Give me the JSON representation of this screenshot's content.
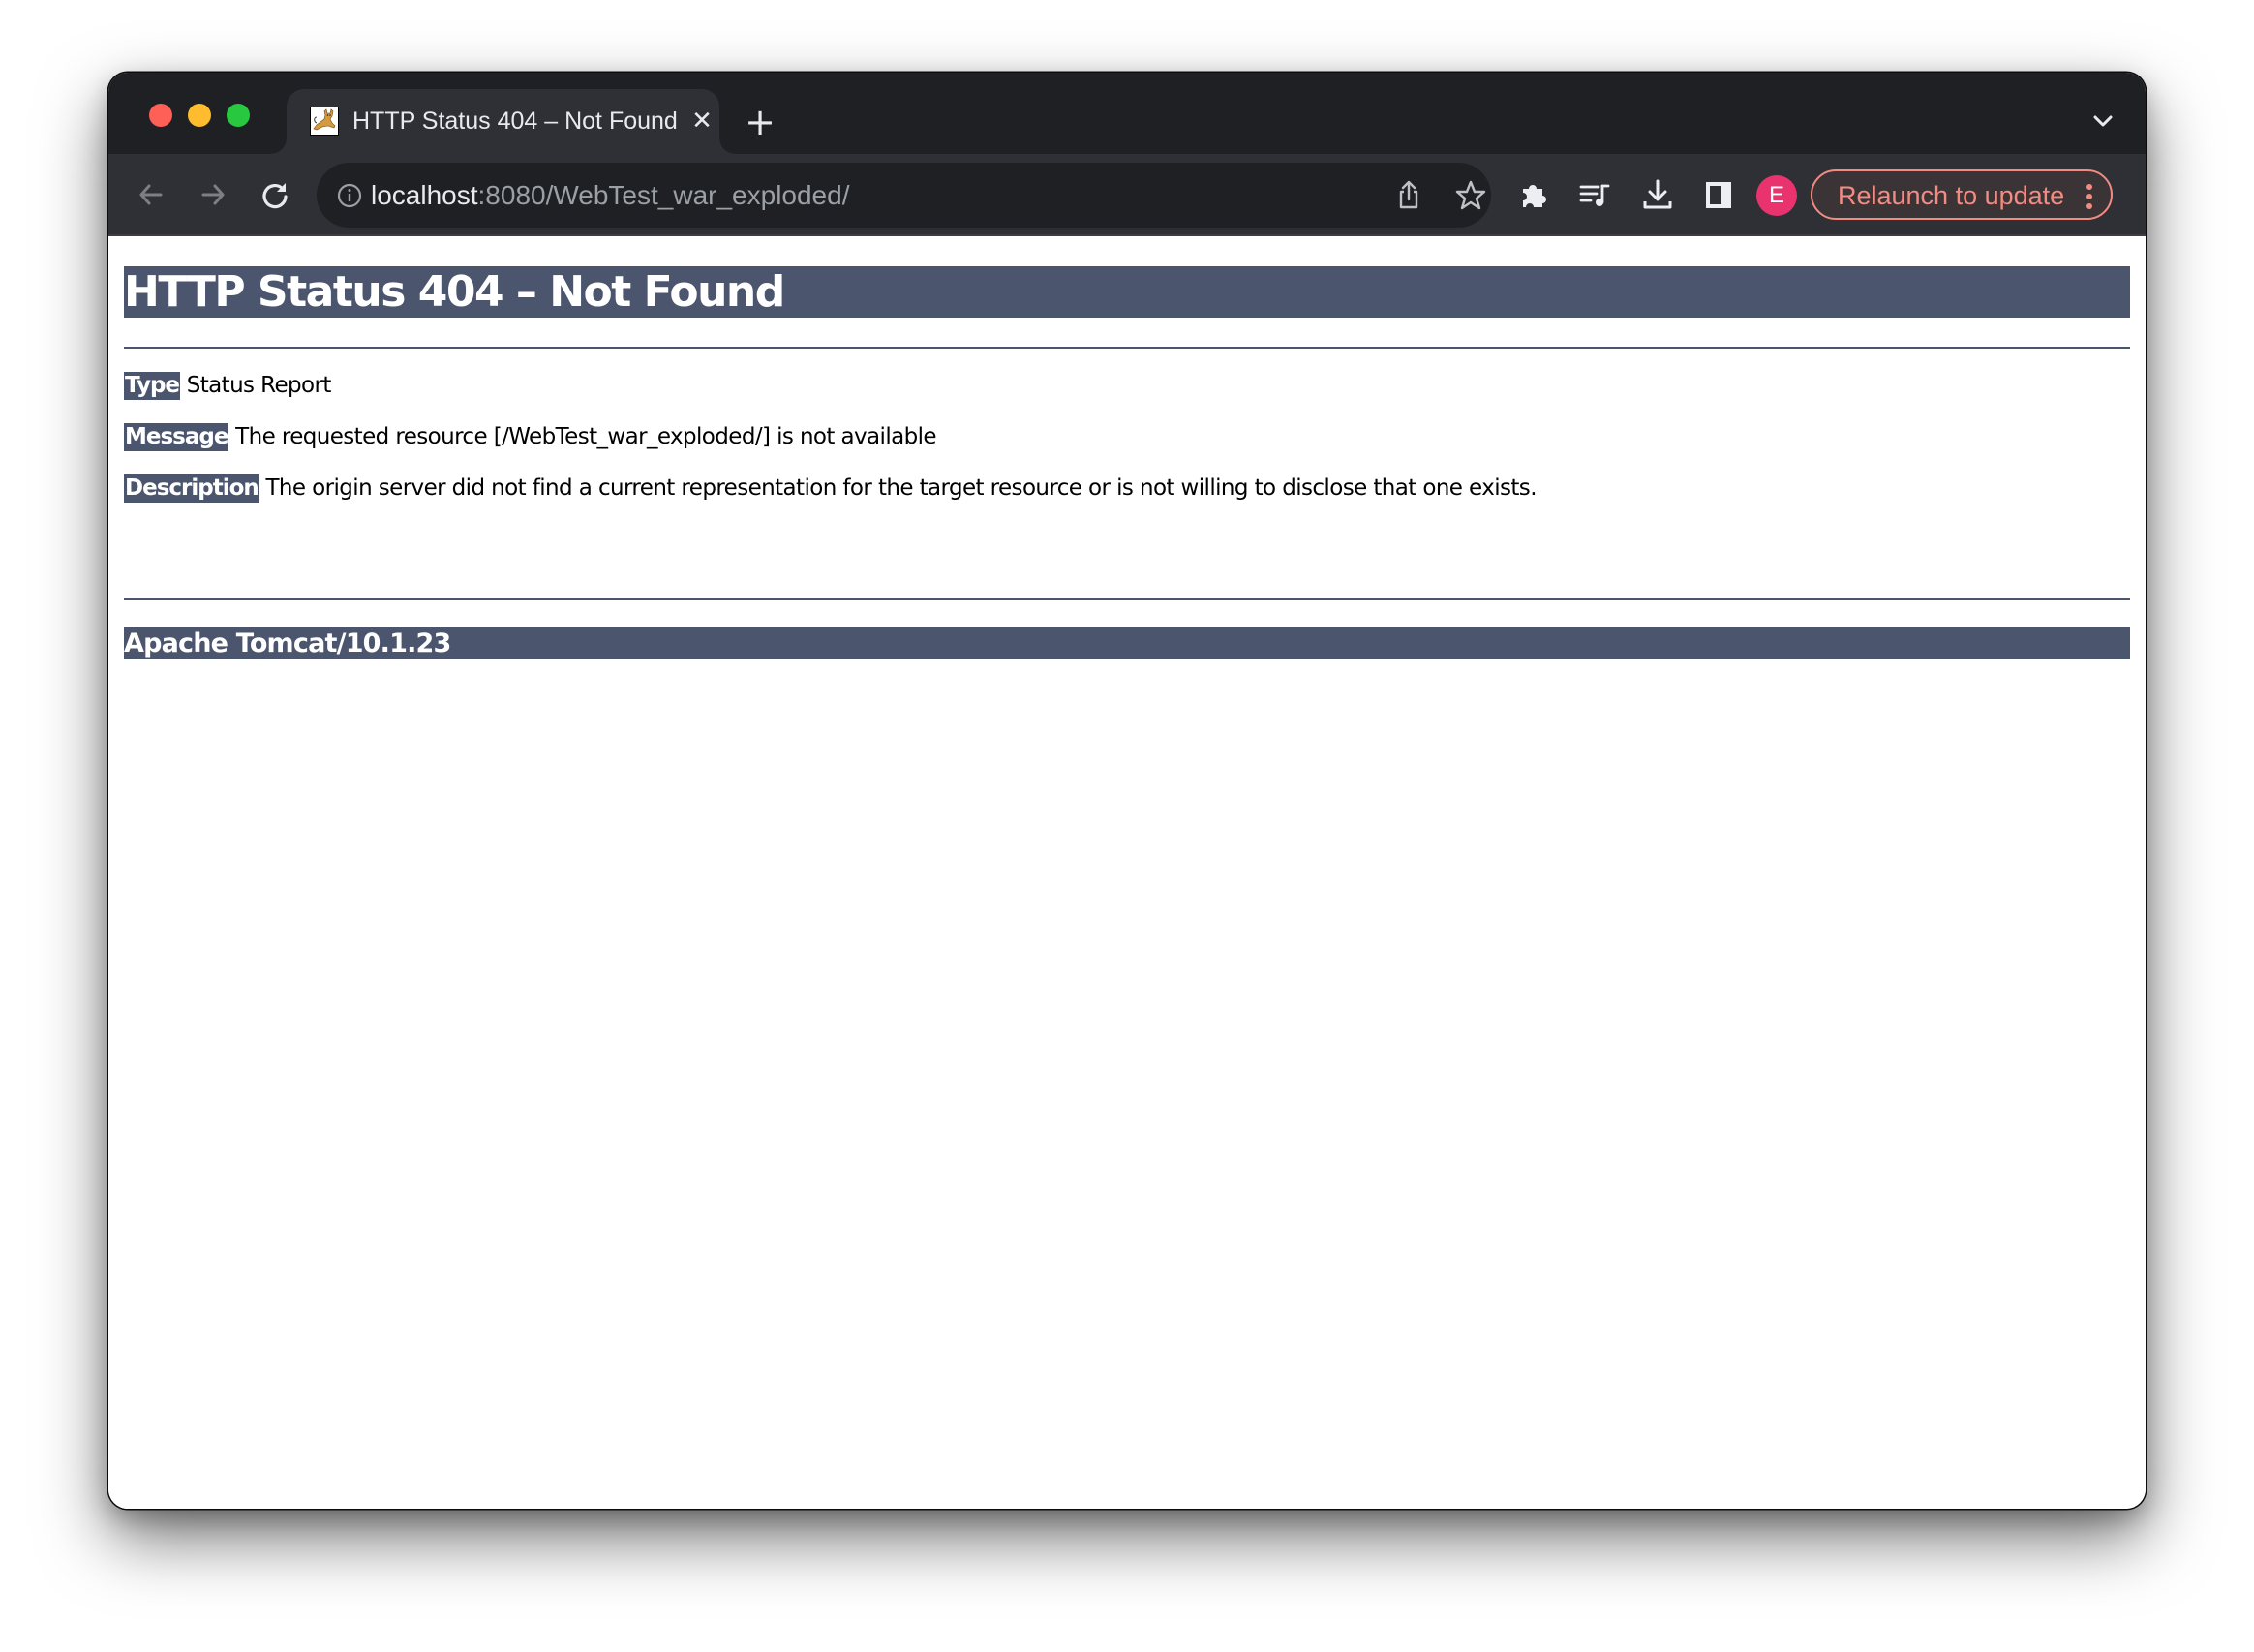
{
  "browser": {
    "tab": {
      "title": "HTTP Status 404 – Not Found",
      "favicon": "tomcat-favicon",
      "close_icon": "close-icon"
    },
    "new_tab_label": "+",
    "address": {
      "host": "localhost",
      "rest": ":8080/WebTest_war_exploded/"
    },
    "profile_initial": "E",
    "relaunch_label": "Relaunch to update",
    "colors": {
      "tabbar_bg": "#1f2023",
      "toolbar_bg": "#2e3035",
      "avatar": "#e8336f",
      "relaunch_accent": "#f28b82"
    },
    "icons": [
      "back-icon",
      "forward-icon",
      "reload-icon",
      "info-icon",
      "share-icon",
      "bookmark-star-icon",
      "extensions-icon",
      "media-queue-icon",
      "download-icon",
      "side-panel-icon",
      "more-vertical-icon",
      "tab-search-chevron-icon"
    ]
  },
  "page": {
    "heading": "HTTP Status 404 – Not Found",
    "fields": [
      {
        "label": "Type",
        "value": "Status Report"
      },
      {
        "label": "Message",
        "value": "The requested resource [/WebTest_war_exploded/] is not available"
      },
      {
        "label": "Description",
        "value": "The origin server did not find a current representation for the target resource or is not willing to disclose that one exists."
      }
    ],
    "footer": "Apache Tomcat/10.1.23",
    "accent_color": "#4b566e"
  }
}
